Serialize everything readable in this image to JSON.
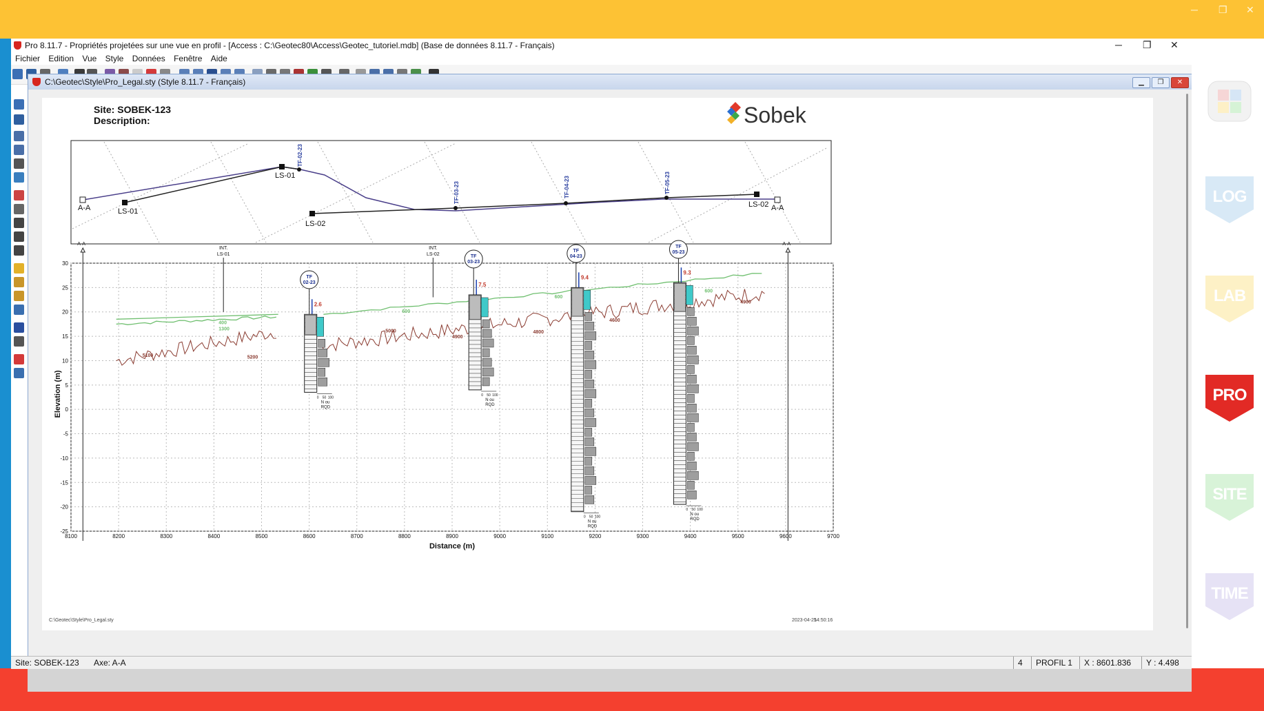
{
  "window": {
    "title": "Pro 8.11.7 - Propriétés projetées sur une vue en profil - [Access : C:\\Geotec80\\Access\\Geotec_tutoriel.mdb] (Base de données 8.11.7 - Français)",
    "controls": [
      "─",
      "❐",
      "✕"
    ]
  },
  "desktop": {
    "controls": [
      "─",
      "❐",
      "✕"
    ]
  },
  "menu": [
    "Fichier",
    "Edition",
    "Vue",
    "Style",
    "Données",
    "Fenêtre",
    "Aide"
  ],
  "doc": {
    "title": "C:\\Geotec\\Style\\Pro_Legal.sty (Style 8.11.7 - Français)",
    "controls": [
      "▁",
      "❐",
      "✕"
    ]
  },
  "sheet": {
    "site_label": "Site: SOBEK-123",
    "description_label": "Description:",
    "logo_text": "Sobek",
    "footer_path": "C:\\Geotec\\Style\\Pro_Legal.sty",
    "footer_date": "2023-04-25",
    "footer_time": "14:50:16"
  },
  "plan": {
    "labels": {
      "aa_left": "A-A",
      "aa_right": "A-A",
      "ls01_a": "LS-01",
      "ls01_b": "LS-01",
      "ls02_a": "LS-02",
      "ls02_b": "LS-02",
      "tf02": "TF-02-23",
      "tf03": "TF-03-23",
      "tf04": "TF-04-23",
      "tf05": "TF-05-23"
    }
  },
  "section": {
    "ylabel": "Elevation (m)",
    "xlabel": "Distance  (m)",
    "x_ticks": [
      8100,
      8200,
      8300,
      8400,
      8500,
      8600,
      8700,
      8800,
      8900,
      9000,
      9100,
      9200,
      9300,
      9400,
      9500,
      9600,
      9700
    ],
    "y_ticks": [
      30,
      25,
      20,
      15,
      10,
      5,
      0,
      -5,
      -10,
      -15,
      -20,
      -25
    ],
    "markers": {
      "aa_left": "A-A",
      "aa_right": "A-A",
      "int_ls01_a": "INT.",
      "int_ls01_b": "LS-01",
      "int_ls02_a": "INT.",
      "int_ls02_b": "LS-02"
    },
    "boreholes": [
      {
        "id_top": "TF",
        "id_bot": "02-23",
        "water": "2.6"
      },
      {
        "id_top": "TF",
        "id_bot": "03-23",
        "water": "7.5"
      },
      {
        "id_top": "TF",
        "id_bot": "04-23",
        "water": "9.4"
      },
      {
        "id_top": "TF",
        "id_bot": "05-23",
        "water": "9.3"
      }
    ],
    "scale": {
      "s0": "0",
      "s50": "50",
      "s100": "100",
      "n": "N ou",
      "rqd": "RQD"
    },
    "values": {
      "g400": "400",
      "g1300": "1300",
      "b5100": "5100",
      "b5200": "5200",
      "g600a": "600",
      "b5000": "5000",
      "b4900a": "4900",
      "g600b": "600",
      "b4800": "4800",
      "b4600": "4600",
      "g600c": "600",
      "b4900b": "4900"
    }
  },
  "status": {
    "site": "Site: SOBEK-123",
    "axe": "Axe: A-A",
    "num": "4",
    "profil": "PROFIL 1",
    "x": "X : 8601.836",
    "y": "Y : 4.498"
  },
  "right_panel": {
    "badges": [
      "LOG",
      "LAB",
      "PRO",
      "SITE",
      "TIME"
    ],
    "colors": {
      "LOG": "#d8e9f6",
      "LAB": "#fdf1c6",
      "PRO": "#e22a25",
      "SITE": "#d8f3d8",
      "TIME": "#e6e2f5"
    }
  },
  "colors": {
    "top_bar": "#fdc234",
    "bottom_bar": "#f4402f",
    "left_strip": "#1a8fd0",
    "ground_line": "#6fbf6f",
    "bedrock_line": "#8a3b30"
  }
}
